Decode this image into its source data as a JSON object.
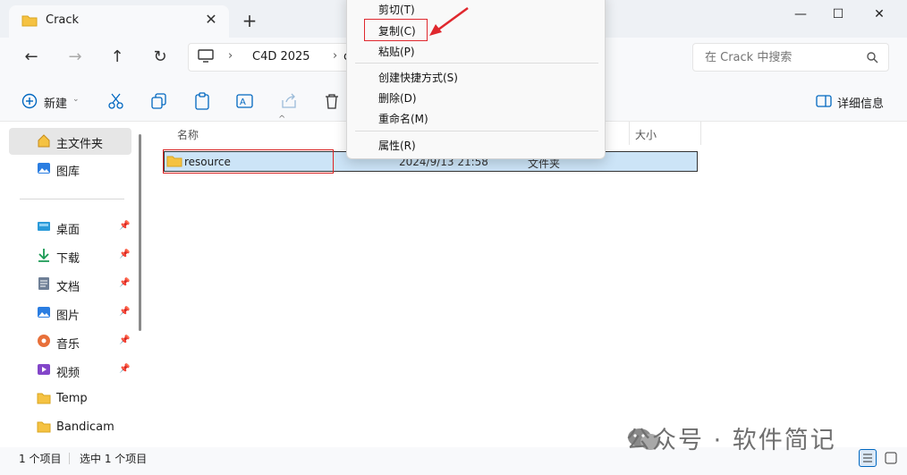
{
  "tab": {
    "title": "Crack"
  },
  "window_controls": {
    "minimize": "—",
    "maximize": "☐",
    "close": "✕"
  },
  "address": {
    "segment": "C4D 2025",
    "partial_segment": "c"
  },
  "search": {
    "placeholder": "在 Crack 中搜索"
  },
  "toolbar": {
    "new_label": "新建",
    "details_label": "详细信息"
  },
  "columns": {
    "name": "名称",
    "size": "大小"
  },
  "file": {
    "name": "resource",
    "modified": "2024/9/13 21:58",
    "type": "文件夹"
  },
  "sidebar": {
    "top_items": [
      {
        "label": "主文件夹",
        "icon": "home-icon"
      },
      {
        "label": "图库",
        "icon": "gallery-icon"
      }
    ],
    "quick_items": [
      {
        "label": "桌面",
        "icon": "desktop-icon",
        "pinned": true
      },
      {
        "label": "下载",
        "icon": "download-icon",
        "pinned": true
      },
      {
        "label": "文档",
        "icon": "document-icon",
        "pinned": true
      },
      {
        "label": "图片",
        "icon": "picture-icon",
        "pinned": true
      },
      {
        "label": "音乐",
        "icon": "music-icon",
        "pinned": true
      },
      {
        "label": "视频",
        "icon": "video-icon",
        "pinned": true
      },
      {
        "label": "Temp",
        "icon": "folder-icon",
        "pinned": false
      },
      {
        "label": "Bandicam",
        "icon": "folder-icon",
        "pinned": false
      }
    ]
  },
  "context_menu": {
    "cut": "剪切(T)",
    "copy": "复制(C)",
    "paste": "粘贴(P)",
    "shortcut": "创建快捷方式(S)",
    "delete": "删除(D)",
    "rename": "重命名(M)",
    "properties": "属性(R)"
  },
  "status": {
    "count": "1 个项目",
    "selected": "选中 1 个项目"
  },
  "watermark": "公众号 · 软件简记",
  "colors": {
    "selection": "#cce4f7",
    "highlight_red": "#e0282e",
    "folder": "#f5c242"
  }
}
